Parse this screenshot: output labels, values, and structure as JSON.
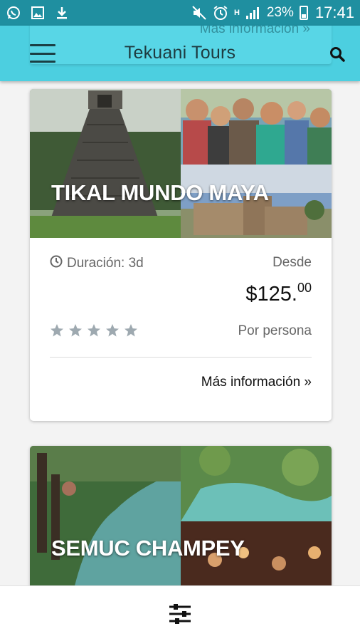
{
  "status_bar": {
    "battery": "23%",
    "time": "17:41",
    "network": "H",
    "icons": [
      "whatsapp-icon",
      "image-icon",
      "download-icon",
      "mute-icon",
      "alarm-icon",
      "signal-icon",
      "battery-icon"
    ]
  },
  "app_bar": {
    "title": "Tekuani Tours",
    "ghost_link": "Más información »",
    "icons": [
      "menu-icon",
      "search-icon"
    ]
  },
  "tours": [
    {
      "name": "TIKAL MUNDO MAYA",
      "duration": "Duración: 3d",
      "from_label": "Desde",
      "price": "$125.",
      "price_cents": "00",
      "rating": 5,
      "per_person": "Por persona",
      "more_info": "Más información »"
    },
    {
      "name": "SEMUC CHAMPEY"
    }
  ],
  "bottom_bar": {
    "icon": "filter-sliders-icon"
  },
  "colors": {
    "status_bar": "#1f8fa0",
    "app_bar": "#4ccfe0",
    "star": "#9ea9b0"
  }
}
